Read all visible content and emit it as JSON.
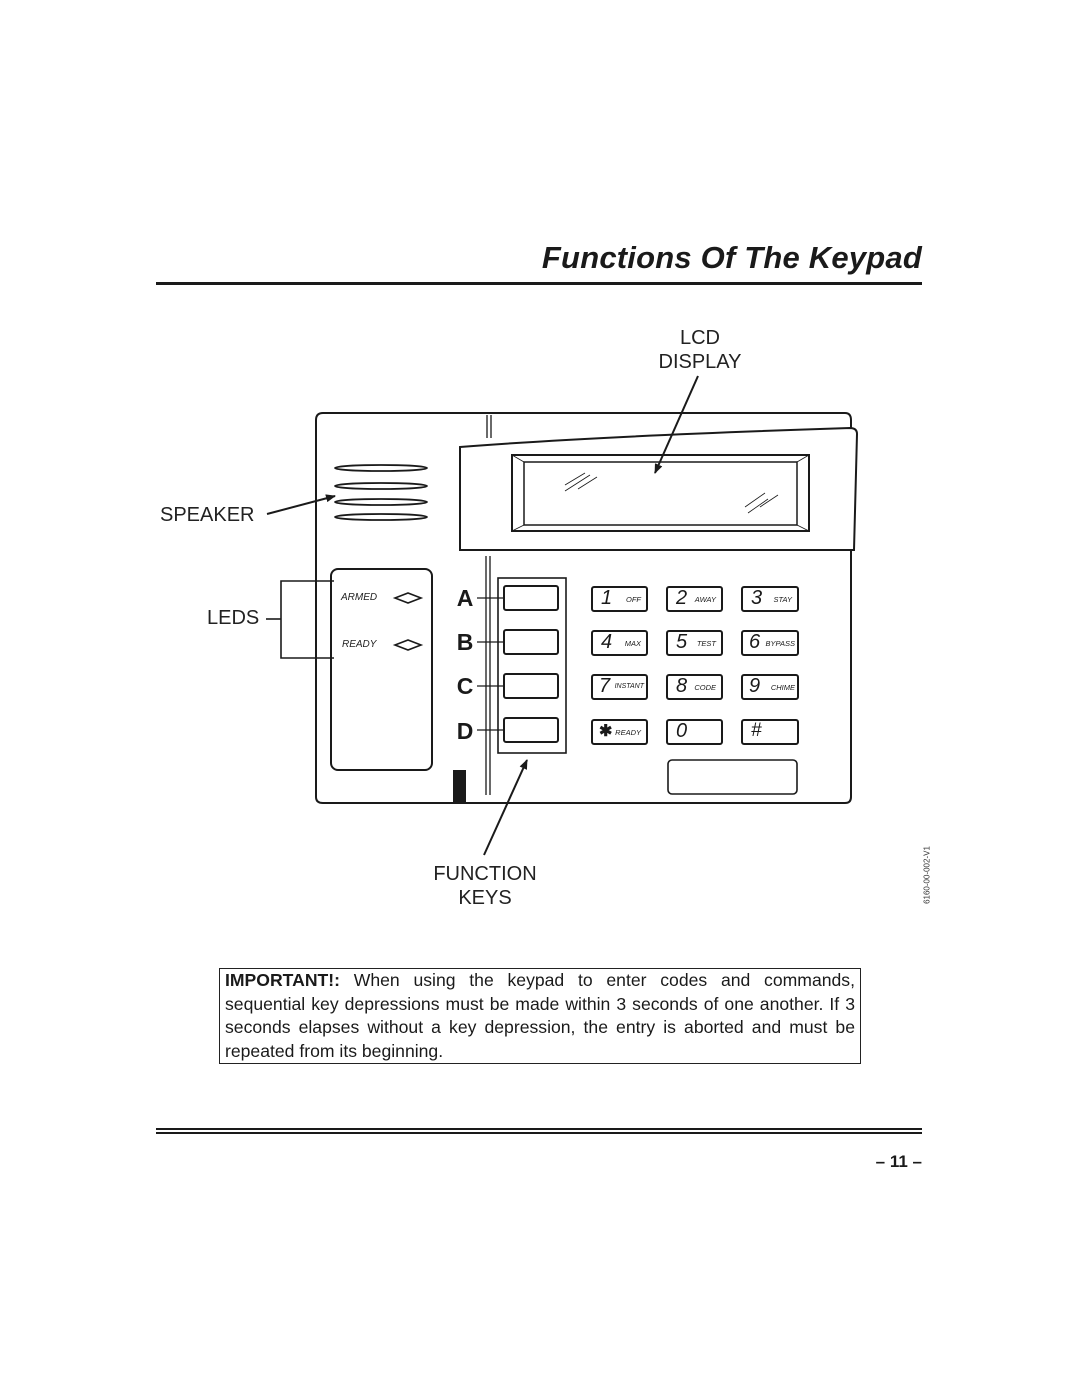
{
  "page": {
    "title": "Functions Of The Keypad",
    "page_number": "– 11 –",
    "figure_code": "6160-00-002-V1"
  },
  "callouts": {
    "lcd_line1": "LCD",
    "lcd_line2": "DISPLAY",
    "speaker": "SPEAKER",
    "leds": "LEDS",
    "function_line1": "FUNCTION",
    "function_line2": "KEYS"
  },
  "leds": [
    {
      "label": "ARMED"
    },
    {
      "label": "READY"
    }
  ],
  "function_keys": [
    "A",
    "B",
    "C",
    "D"
  ],
  "keys": [
    {
      "num": "1",
      "sub": "OFF"
    },
    {
      "num": "2",
      "sub": "AWAY"
    },
    {
      "num": "3",
      "sub": "STAY"
    },
    {
      "num": "4",
      "sub": "MAX"
    },
    {
      "num": "5",
      "sub": "TEST"
    },
    {
      "num": "6",
      "sub": "BYPASS"
    },
    {
      "num": "7",
      "sub": "INSTANT"
    },
    {
      "num": "8",
      "sub": "CODE"
    },
    {
      "num": "9",
      "sub": "CHIME"
    },
    {
      "num": "✱",
      "sub": "READY"
    },
    {
      "num": "0",
      "sub": ""
    },
    {
      "num": "#",
      "sub": ""
    }
  ],
  "important": {
    "lead": "IMPORTANT!:",
    "text": " When using the keypad to enter codes and commands, sequential key depressions must be made within 3 seconds of one another. If 3 seconds elapses without a key depression, the entry is aborted and must be repeated from its beginning."
  }
}
